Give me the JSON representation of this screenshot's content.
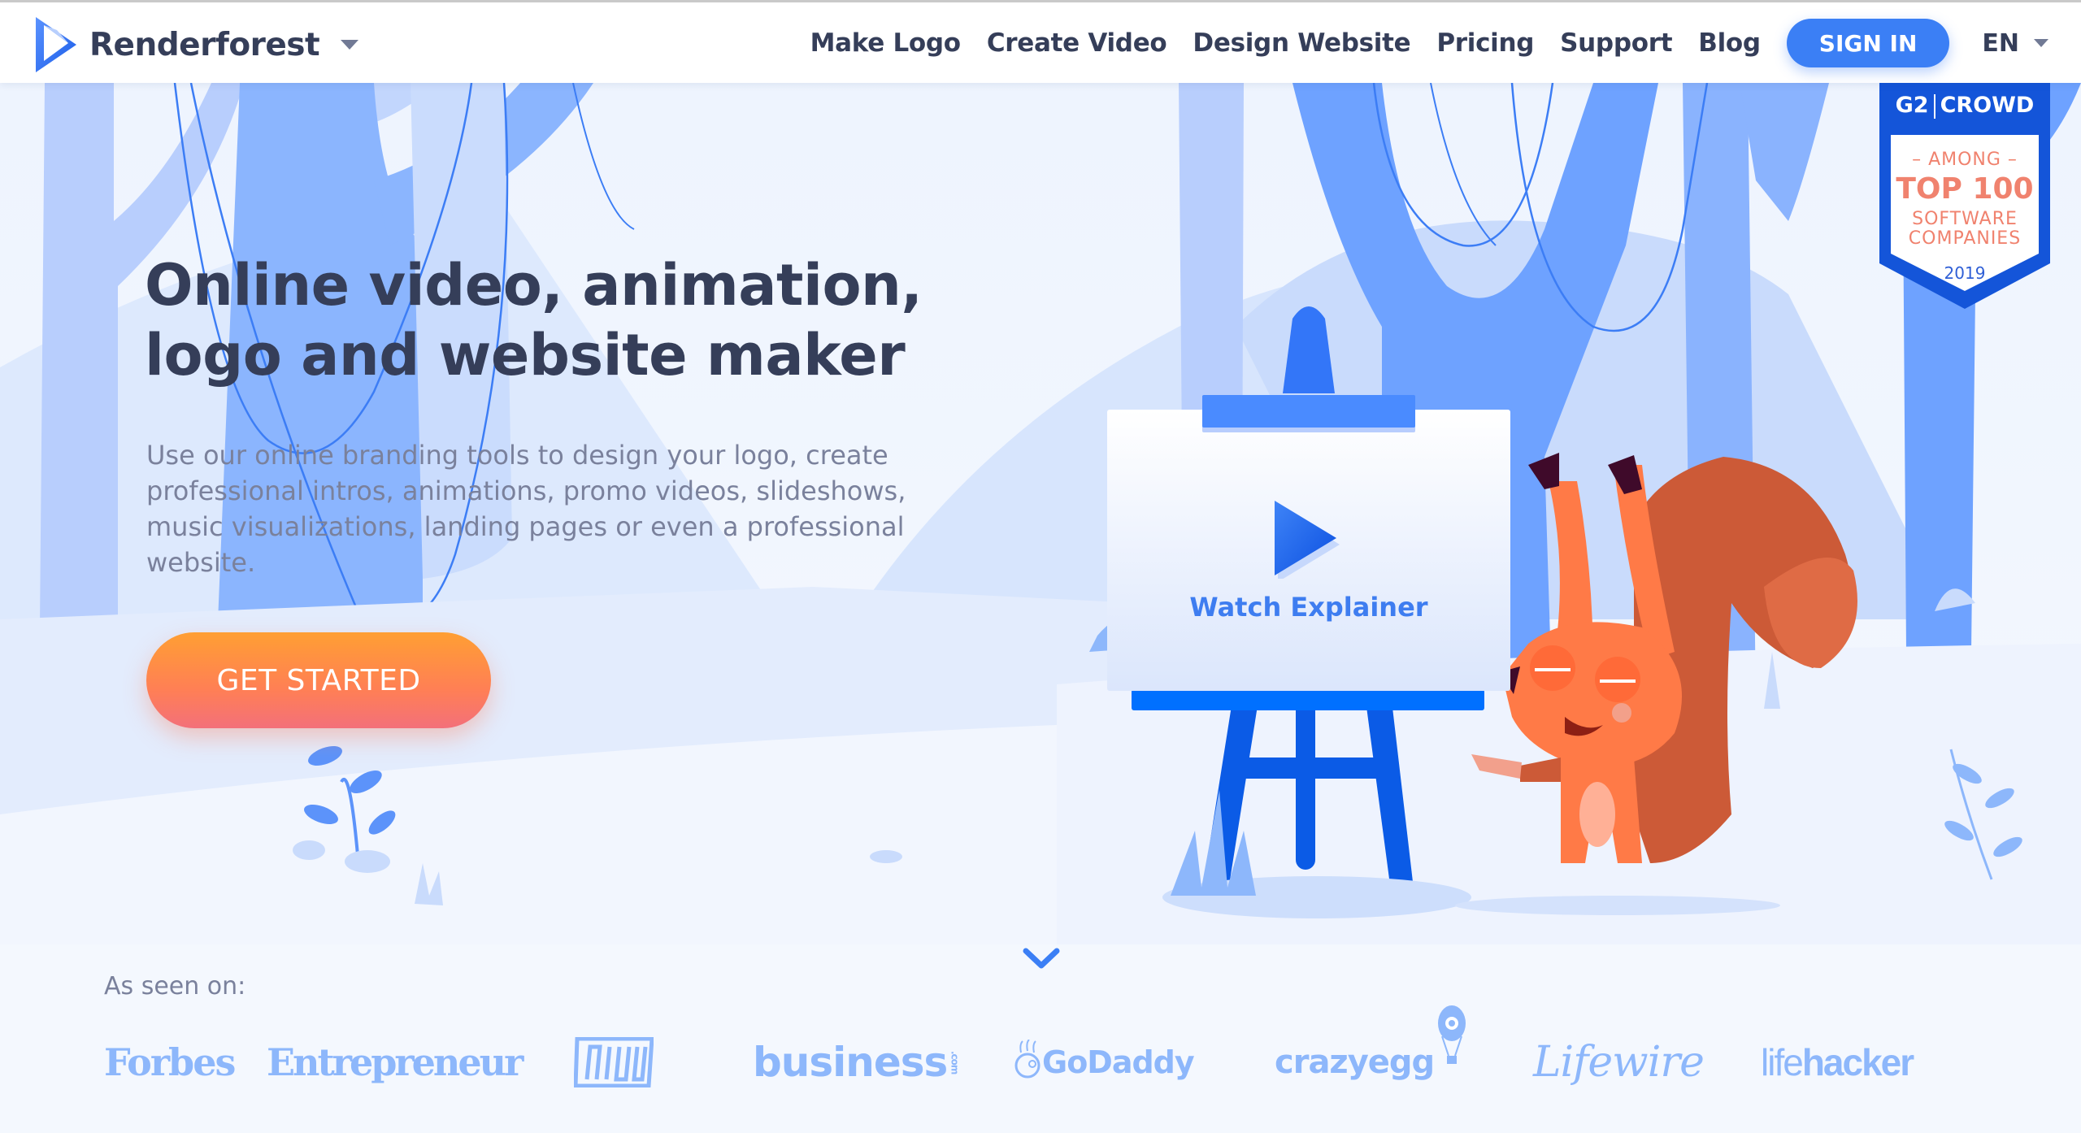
{
  "header": {
    "brand": "Renderforest",
    "nav": [
      "Make Logo",
      "Create Video",
      "Design Website",
      "Pricing",
      "Support",
      "Blog"
    ],
    "sign_in": "SIGN IN",
    "language": "EN"
  },
  "hero": {
    "title_line1": "Online video, animation,",
    "title_line2": "logo and website maker",
    "description": "Use our online branding tools to design your logo, create professional intros, animations, promo videos, slideshows, music visualizations, landing pages or even a professional website.",
    "cta": "GET STARTED"
  },
  "explainer": {
    "label": "Watch Explainer",
    "icon": "play-icon"
  },
  "badge": {
    "brand": "G2",
    "brand_sup": "2",
    "brand_word": "CROWD",
    "among": "– AMONG –",
    "top": "TOP 100",
    "software": "SOFTWARE",
    "companies": "COMPANIES",
    "year": "2019"
  },
  "press": {
    "label": "As seen on:",
    "logos": {
      "forbes": "Forbes",
      "entrepreneur": "Entrepreneur",
      "muo": "MUO",
      "business": "business",
      "business_suffix": ".com",
      "godaddy": "GoDaddy",
      "crazyegg": "crazyegg",
      "lifewire": "Lifewire",
      "lifehacker_a": "life",
      "lifehacker_b": "hacker"
    }
  },
  "colors": {
    "brand_dark": "#353e59",
    "accent_blue": "#3b7ff5",
    "cta_orange": "#ff8a45",
    "press_blue": "#8db7fb",
    "badge_blue": "#1455d9",
    "badge_coral": "#f0826e"
  }
}
